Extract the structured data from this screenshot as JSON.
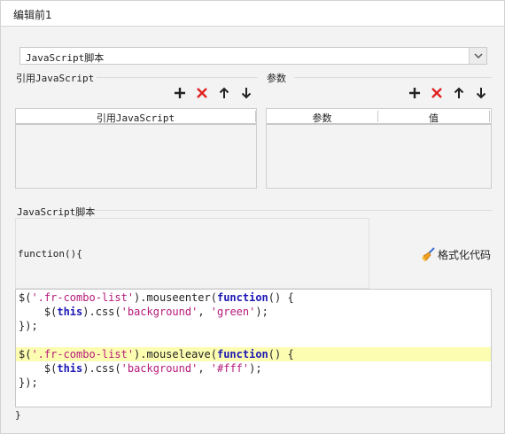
{
  "dialog": {
    "title": "编辑前1"
  },
  "script_type": {
    "selected": "JavaScript脚本"
  },
  "references": {
    "label": "引用JavaScript",
    "column": "引用JavaScript"
  },
  "params": {
    "label": "参数",
    "columns": [
      "参数",
      "值"
    ]
  },
  "script": {
    "label": "JavaScript脚本",
    "header": "function(){",
    "format_label": "格式化代码",
    "closing": "}",
    "code": [
      {
        "highlight": false,
        "tokens": [
          {
            "t": "$(",
            "c": "plain"
          },
          {
            "t": "'.fr-combo-list'",
            "c": "str"
          },
          {
            "t": ").mouseenter(",
            "c": "plain"
          },
          {
            "t": "function",
            "c": "kw"
          },
          {
            "t": "() {",
            "c": "plain"
          }
        ]
      },
      {
        "highlight": false,
        "tokens": [
          {
            "t": "    $(",
            "c": "plain"
          },
          {
            "t": "this",
            "c": "kw"
          },
          {
            "t": ").css(",
            "c": "plain"
          },
          {
            "t": "'background'",
            "c": "str"
          },
          {
            "t": ", ",
            "c": "plain"
          },
          {
            "t": "'green'",
            "c": "str"
          },
          {
            "t": ");",
            "c": "plain"
          }
        ]
      },
      {
        "highlight": false,
        "tokens": [
          {
            "t": "});",
            "c": "plain"
          }
        ]
      },
      {
        "highlight": false,
        "tokens": []
      },
      {
        "highlight": true,
        "tokens": [
          {
            "t": "$(",
            "c": "plain"
          },
          {
            "t": "'.fr-combo-list'",
            "c": "str"
          },
          {
            "t": ").mouseleave(",
            "c": "plain"
          },
          {
            "t": "function",
            "c": "kw"
          },
          {
            "t": "() {",
            "c": "plain"
          }
        ]
      },
      {
        "highlight": false,
        "tokens": [
          {
            "t": "    $(",
            "c": "plain"
          },
          {
            "t": "this",
            "c": "kw"
          },
          {
            "t": ").css(",
            "c": "plain"
          },
          {
            "t": "'background'",
            "c": "str"
          },
          {
            "t": ", ",
            "c": "plain"
          },
          {
            "t": "'#fff'",
            "c": "str"
          },
          {
            "t": ");",
            "c": "plain"
          }
        ]
      },
      {
        "highlight": false,
        "tokens": [
          {
            "t": "});",
            "c": "plain"
          }
        ]
      }
    ]
  },
  "icons": {
    "add": "plus-icon",
    "delete": "red-x-icon",
    "up": "arrow-up-icon",
    "down": "arrow-down-icon",
    "format": "broom-icon"
  },
  "colors": {
    "delete_red": "#e02020",
    "string": "#b5197a",
    "keyword": "#1c17b3",
    "highlight": "#fdfdb2"
  }
}
